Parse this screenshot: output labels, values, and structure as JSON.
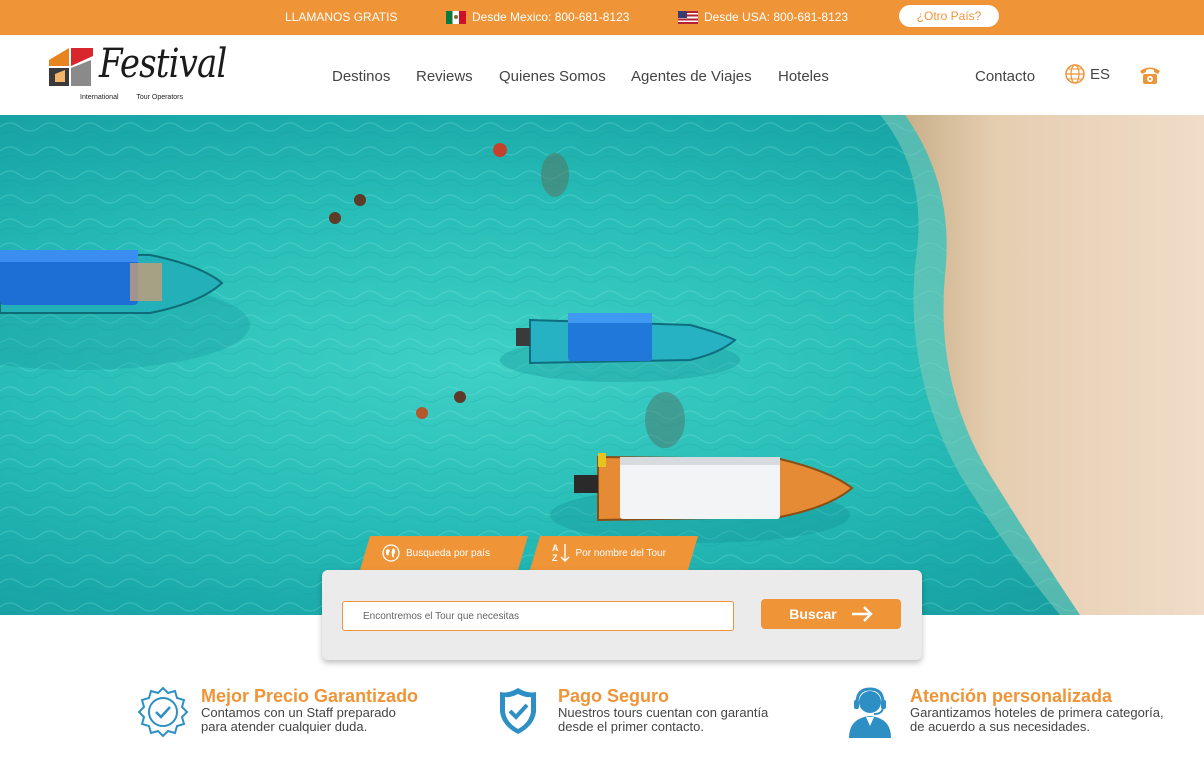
{
  "topbar": {
    "llamanos": "LLAMANOS GRATIS",
    "mexico": "Desde Mexico: 800-681-8123",
    "usa": "Desde USA: 800-681-8123",
    "otro_pais": "¿Otro País?"
  },
  "logo": {
    "word": "Festival",
    "tag_left": "International",
    "tag_right": "Tour Operators"
  },
  "nav": {
    "items": [
      "Destinos",
      "Reviews",
      "Quienes Somos",
      "Agentes de Viajes",
      "Hoteles"
    ],
    "contacto": "Contacto",
    "language": "ES"
  },
  "search": {
    "tabs": [
      "Busqueda por país",
      "Por nombre del Tour"
    ],
    "az_top": "A",
    "az_bottom": "Z",
    "placeholder": "Encontremos el Tour que necesitas",
    "button": "Buscar"
  },
  "features": [
    {
      "title": "Mejor Precio Garantizado",
      "line1": "Contamos con un Staff preparado",
      "line2": "para atender cualquier duda.",
      "icon": "badge-check-icon"
    },
    {
      "title": "Pago Seguro",
      "line1": "Nuestros tours cuentan con garantía",
      "line2": "desde el primer contacto.",
      "icon": "shield-check-icon"
    },
    {
      "title": "Atención personalizada",
      "line1": "Garantizamos hoteles de primera categoría,",
      "line2": "de acuerdo a sus necesidades.",
      "icon": "headset-agent-icon"
    }
  ],
  "colors": {
    "accent": "#ef9437",
    "icon_blue": "#2e8fc4"
  }
}
